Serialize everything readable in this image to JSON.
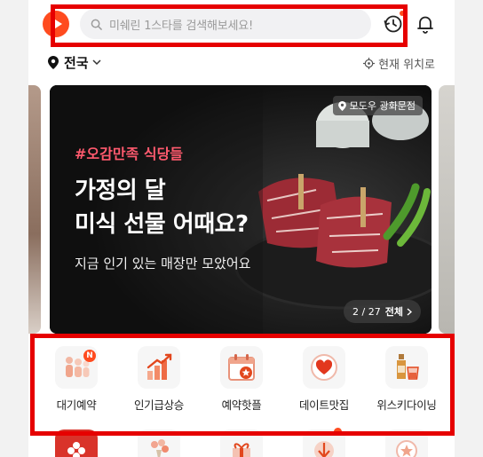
{
  "search": {
    "placeholder": "미쉐린 1스타를 검색해보세요!"
  },
  "location": {
    "region": "전국",
    "current_location": "현재 위치로"
  },
  "banner": {
    "place": "모도우 광화문점",
    "tag": "#오감만족 식당들",
    "title_line1": "가정의 달",
    "title_line2": "미식 선물 어때요?",
    "subtitle": "지금 인기 있는 매장만 모았어요",
    "page_indicator": "2 / 27",
    "view_all": "전체"
  },
  "categories": [
    {
      "label": "대기예약",
      "icon": "waitlist-icon",
      "badge": "N"
    },
    {
      "label": "인기급상승",
      "icon": "trending-up-icon"
    },
    {
      "label": "예약핫플",
      "icon": "calendar-star-icon"
    },
    {
      "label": "데이트맛집",
      "icon": "heart-icon"
    },
    {
      "label": "위스키다이닝",
      "icon": "whisky-icon"
    }
  ],
  "colors": {
    "brand": "#ff4b1f",
    "annotation": "#e60000"
  }
}
